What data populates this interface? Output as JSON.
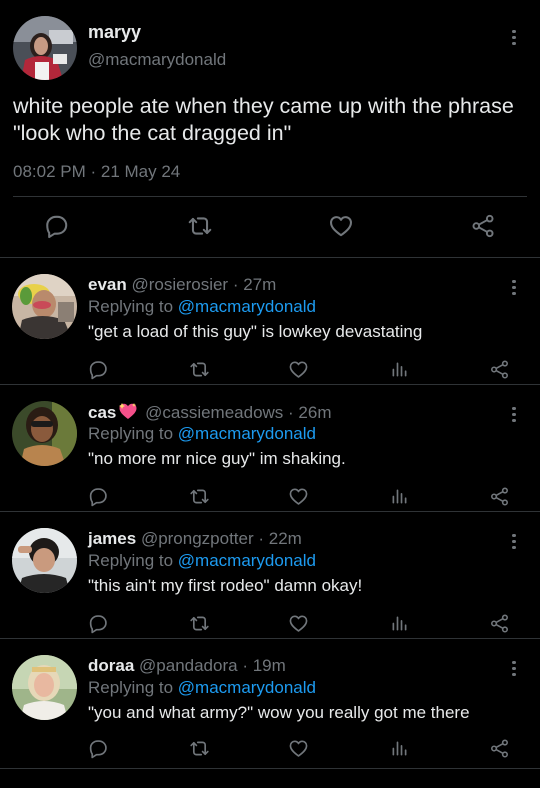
{
  "main_tweet": {
    "display_name": "maryy",
    "handle": "@macmarydonald",
    "text": "white people ate when they came up with the phrase \"look who the cat dragged in\"",
    "time": "08:02 PM",
    "date": "21 May 24",
    "meta_separator": " · "
  },
  "replying_to_label": "Replying to ",
  "replies": [
    {
      "name": "evan",
      "handle": "@rosierosier",
      "time": "27m",
      "mention": "@macmarydonald",
      "text": "\"get a load of this guy\" is lowkey devastating"
    },
    {
      "name": "cas",
      "handle": "@cassiemeadows",
      "time": "26m",
      "mention": "@macmarydonald",
      "text": "\"no more mr nice guy\" im shaking."
    },
    {
      "name": "james",
      "handle": "@prongzpotter",
      "time": "22m",
      "mention": "@macmarydonald",
      "text": "\"this ain't my first rodeo\" damn okay!"
    },
    {
      "name": "doraa",
      "handle": "@pandadora",
      "time": "19m",
      "mention": "@macmarydonald",
      "text": "\"you and what army?\" wow you really got me there"
    }
  ],
  "colors": {
    "background": "#000000",
    "text": "#e7e9ea",
    "muted": "#71767b",
    "link": "#1d9bf0",
    "divider": "#2f3336"
  },
  "icons": [
    "reply-icon",
    "retweet-icon",
    "like-icon",
    "views-icon",
    "share-icon",
    "more-icon",
    "sparkling-heart-emoji"
  ]
}
